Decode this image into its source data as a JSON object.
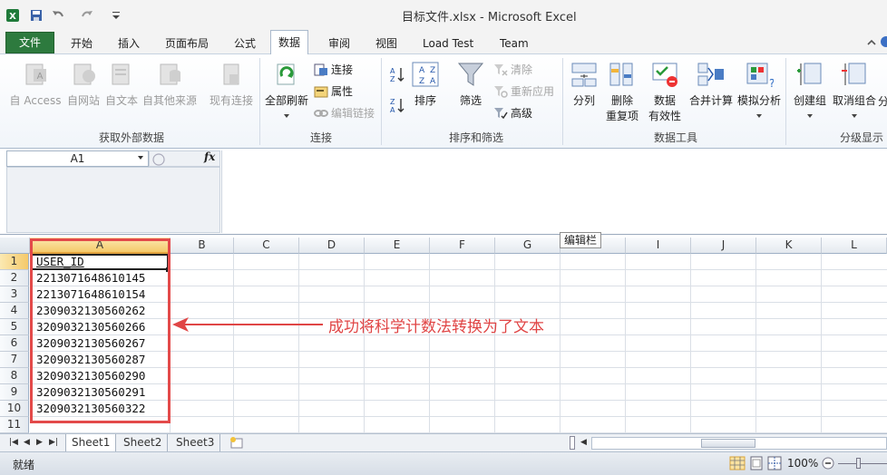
{
  "window": {
    "title": "目标文件.xlsx - Microsoft Excel"
  },
  "tabs": [
    {
      "label": "文件"
    },
    {
      "label": "开始"
    },
    {
      "label": "插入"
    },
    {
      "label": "页面布局"
    },
    {
      "label": "公式"
    },
    {
      "label": "数据"
    },
    {
      "label": "审阅"
    },
    {
      "label": "视图"
    },
    {
      "label": "Load Test"
    },
    {
      "label": "Team"
    }
  ],
  "ribbon": {
    "get_external": {
      "group_label": "获取外部数据",
      "access": "自 Access",
      "web": "自网站",
      "text": "自文本",
      "other": "自其他来源",
      "existing": "现有连接"
    },
    "connections": {
      "group_label": "连接",
      "refresh_all": "全部刷新",
      "connections": "连接",
      "properties": "属性",
      "edit_links": "编辑链接"
    },
    "sort_filter": {
      "group_label": "排序和筛选",
      "sort": "排序",
      "filter": "筛选",
      "clear": "清除",
      "reapply": "重新应用",
      "advanced": "高级"
    },
    "data_tools": {
      "group_label": "数据工具",
      "text_to_columns": "分列",
      "remove_dup_1": "删除",
      "remove_dup_2": "重复项",
      "validation_1": "数据",
      "validation_2": "有效性",
      "consolidate": "合并计算",
      "what_if": "模拟分析"
    },
    "outline": {
      "group_label": "分级显示",
      "group": "创建组",
      "ungroup": "取消组合",
      "subtotal": "分"
    }
  },
  "formula_bar": {
    "name_box": "A1",
    "fx": "fx",
    "tooltip": "编辑栏"
  },
  "columns": [
    "A",
    "B",
    "C",
    "D",
    "E",
    "F",
    "G",
    "H",
    "I",
    "J",
    "K",
    "L"
  ],
  "rows": [
    "1",
    "2",
    "3",
    "4",
    "5",
    "6",
    "7",
    "8",
    "9",
    "10",
    "11"
  ],
  "cells": [
    "USER_ID",
    "2213071648610145",
    "2213071648610154",
    "2309032130560262",
    "3209032130560266",
    "3209032130560267",
    "3209032130560287",
    "3209032130560290",
    "3209032130560291",
    "3209032130560322"
  ],
  "annotation": "成功将科学计数法转换为了文本",
  "sheets": [
    "Sheet1",
    "Sheet2",
    "Sheet3"
  ],
  "status": {
    "ready": "就绪",
    "zoom": "100%"
  },
  "colors": {
    "file_tab": "#2d7a3e",
    "annotation": "#e04545",
    "selection": "#f5c96a"
  }
}
